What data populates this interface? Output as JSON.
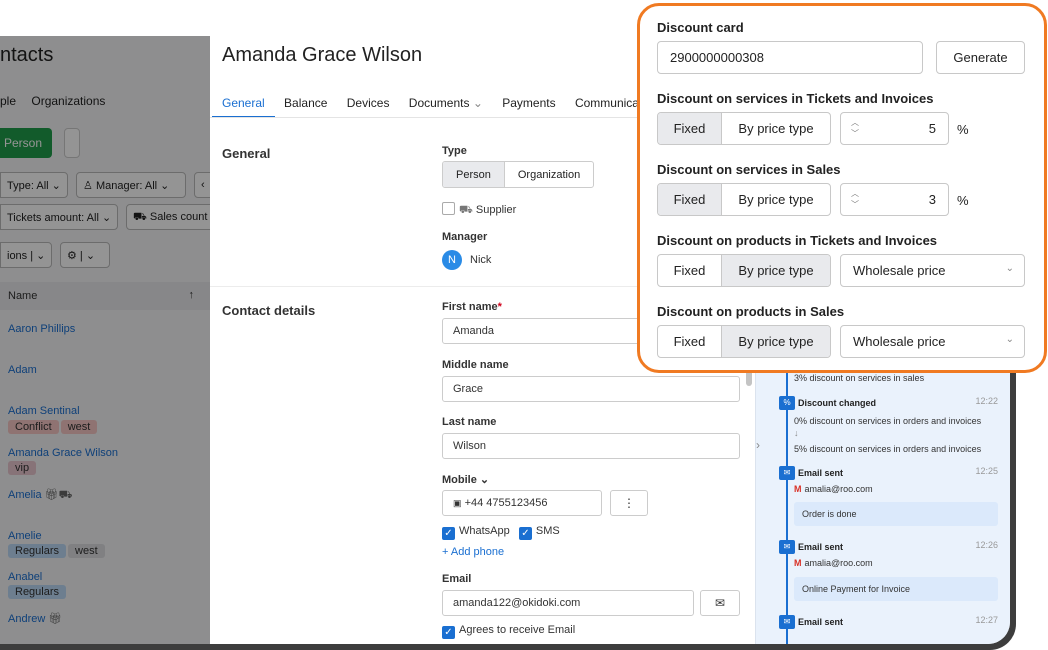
{
  "contacts": {
    "title": "ntacts",
    "tabs": [
      "ple",
      "Organizations"
    ],
    "add_button": "Person",
    "filters": {
      "type": "Type: All",
      "manager": "Manager: All",
      "tickets": "Tickets amount: All",
      "sales": "Sales count",
      "options": "ions"
    },
    "column_header": "Name",
    "rows": [
      {
        "name": "Aaron Phillips",
        "tags": []
      },
      {
        "name": "Adam",
        "tags": []
      },
      {
        "name": "Adam Sentinal",
        "tags": [
          "Conflict",
          "west"
        ]
      },
      {
        "name": "Amanda Grace Wilson",
        "tags": [
          "vip"
        ]
      },
      {
        "name": "Amelia",
        "tags": []
      },
      {
        "name": "Amelie",
        "tags": [
          "Regulars",
          "west"
        ]
      },
      {
        "name": "Anabel",
        "tags": [
          "Regulars"
        ]
      },
      {
        "name": "Andrew",
        "tags": []
      }
    ]
  },
  "card": {
    "title": "Amanda Grace Wilson",
    "tabs": [
      "General",
      "Balance",
      "Devices",
      "Documents",
      "Payments",
      "Communica"
    ],
    "general_section": "General",
    "type_label": "Type",
    "type_options": [
      "Person",
      "Organization"
    ],
    "supplier_label": "Supplier",
    "manager_label": "Manager",
    "manager_initial": "N",
    "manager_name": "Nick",
    "contact_section": "Contact details",
    "first_name_label": "First name",
    "first_name": "Amanda",
    "middle_name_label": "Middle name",
    "middle_name": "Grace",
    "last_name_label": "Last name",
    "last_name": "Wilson",
    "mobile_label": "Mobile",
    "mobile": "+44 4755123456",
    "whatsapp_label": "WhatsApp",
    "sms_label": "SMS",
    "add_phone": "+ Add phone",
    "email_label": "Email",
    "email": "amanda122@okidoki.com",
    "agrees_label": "Agrees to receive Email"
  },
  "timeline": {
    "top_text": "3% discount on services in sales",
    "events": [
      {
        "title": "Discount changed",
        "time": "12:22",
        "lines": [
          "0% discount on services in orders and invoices",
          "↓",
          "5% discount on services in orders and invoices"
        ]
      },
      {
        "title": "Email sent",
        "time": "12:25",
        "email": "amalia@roo.com",
        "message": "Order is done"
      },
      {
        "title": "Email sent",
        "time": "12:26",
        "email": "amalia@roo.com",
        "message": "Online Payment for Invoice"
      },
      {
        "title": "Email sent",
        "time": "12:27"
      }
    ]
  },
  "discount_panel": {
    "card_label": "Discount card",
    "card_number": "2900000000308",
    "generate_label": "Generate",
    "services_tickets_label": "Discount on services in Tickets and Invoices",
    "services_sales_label": "Discount on services in Sales",
    "products_tickets_label": "Discount on products in Tickets and Invoices",
    "products_sales_label": "Discount on products in Sales",
    "fixed_label": "Fixed",
    "by_price_type_label": "By price type",
    "services_tickets_value": "5",
    "services_sales_value": "3",
    "percent_sign": "%",
    "price_type_value": "Wholesale price",
    "accent_color": "#f07a22"
  }
}
